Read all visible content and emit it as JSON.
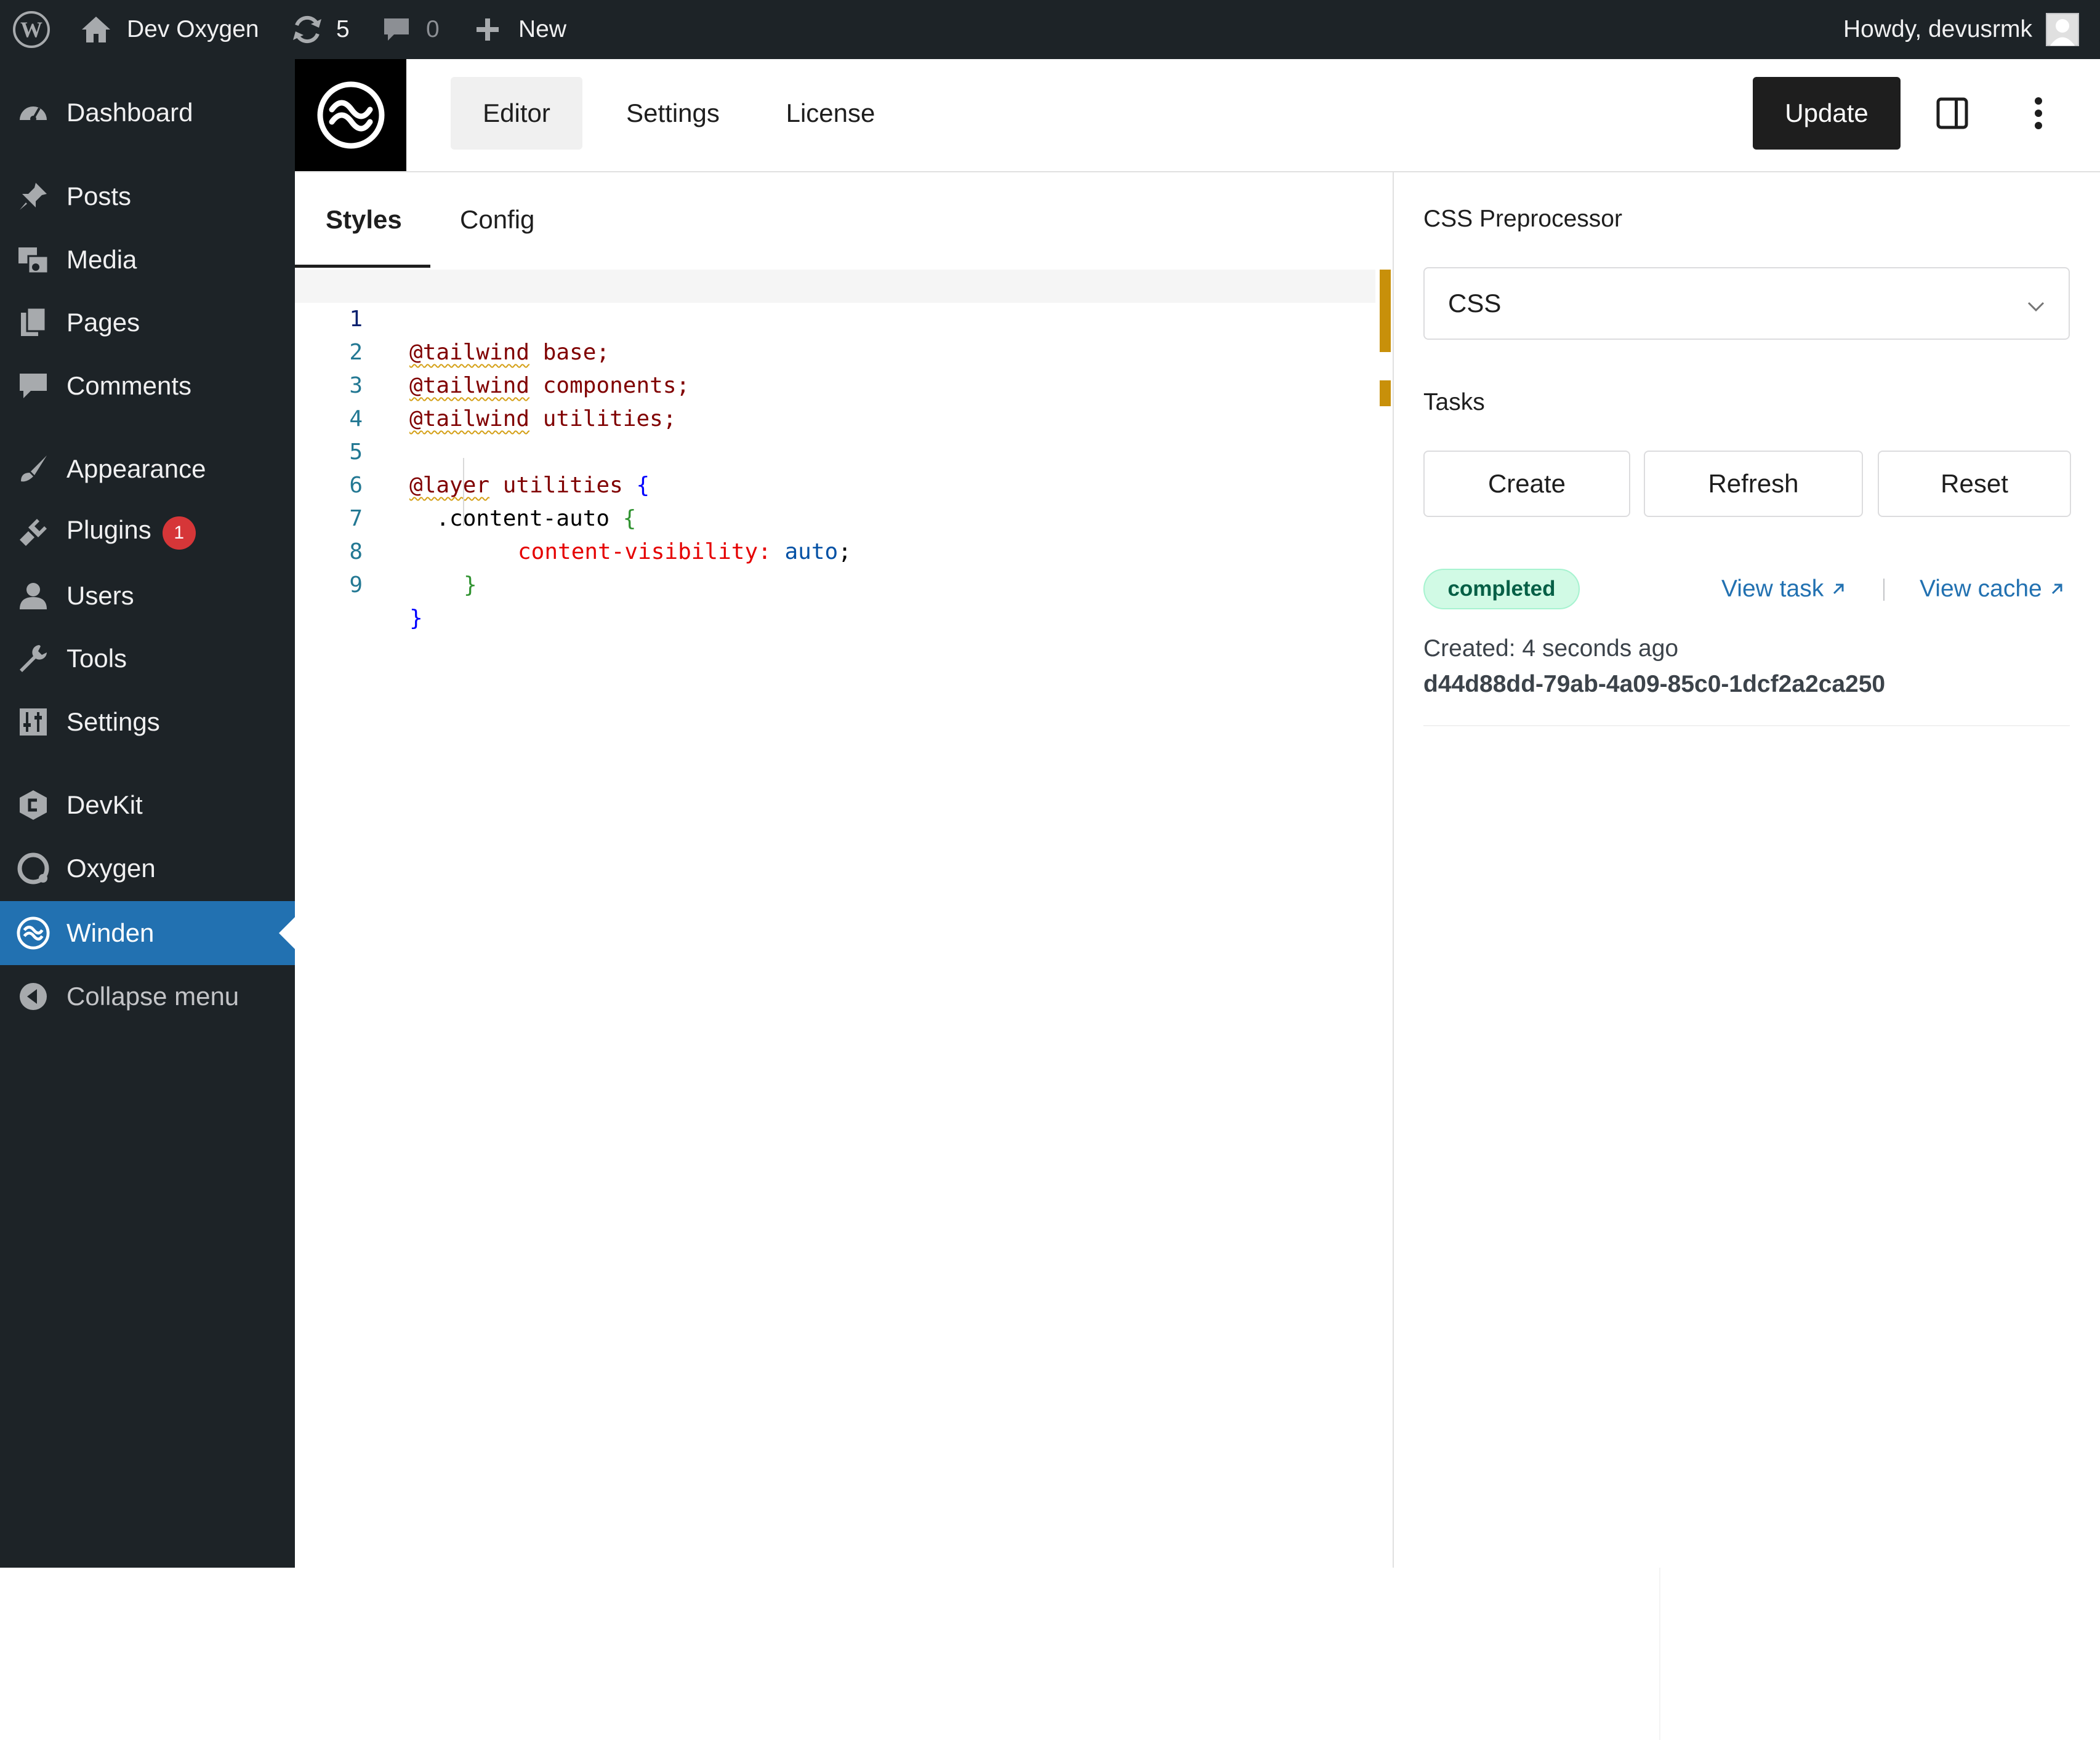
{
  "admin_bar": {
    "site_name": "Dev Oxygen",
    "updates_count": "5",
    "comments_count": "0",
    "new_label": "New",
    "howdy": "Howdy, devusrmk"
  },
  "sidebar": {
    "items": [
      {
        "label": "Dashboard",
        "icon": "dashboard-icon"
      },
      {
        "label": "Posts",
        "icon": "pin-icon"
      },
      {
        "label": "Media",
        "icon": "media-icon"
      },
      {
        "label": "Pages",
        "icon": "pages-icon"
      },
      {
        "label": "Comments",
        "icon": "comment-icon"
      },
      {
        "label": "Appearance",
        "icon": "brush-icon"
      },
      {
        "label": "Plugins",
        "icon": "plugin-icon",
        "badge": "1"
      },
      {
        "label": "Users",
        "icon": "user-icon"
      },
      {
        "label": "Tools",
        "icon": "wrench-icon"
      },
      {
        "label": "Settings",
        "icon": "sliders-icon"
      },
      {
        "label": "DevKit",
        "icon": "devkit-icon"
      },
      {
        "label": "Oxygen",
        "icon": "oxygen-icon"
      },
      {
        "label": "Winden",
        "icon": "winden-icon",
        "active": true
      },
      {
        "label": "Collapse menu",
        "icon": "collapse-icon"
      }
    ],
    "active_color": "#2271b1"
  },
  "header": {
    "tabs": [
      "Editor",
      "Settings",
      "License"
    ],
    "active_tab": "Editor",
    "update_label": "Update"
  },
  "editor": {
    "tabs": [
      "Styles",
      "Config"
    ],
    "active_tab": "Styles",
    "line_numbers": [
      "1",
      "2",
      "3",
      "4",
      "5",
      "6",
      "7",
      "8",
      "9"
    ],
    "lines": [
      {
        "at": "@",
        "kw": "tailwind",
        "rest": " base;"
      },
      {
        "at": "@",
        "kw": "tailwind",
        "rest": " components;"
      },
      {
        "at": "@",
        "kw": "tailwind",
        "rest": " utilities;"
      },
      {
        "empty": ""
      },
      {
        "at": "@",
        "kw": "layer",
        "rest": " utilities ",
        "brace": "{"
      },
      {
        "selector": "  .content-auto ",
        "brace": "{"
      },
      {
        "prop": "content-visibility:",
        "value": " auto",
        "semi": ";"
      },
      {
        "brace": "}"
      },
      {
        "brace": "}"
      }
    ]
  },
  "panel": {
    "preprocessor_label": "CSS Preprocessor",
    "preprocessor_value": "CSS",
    "tasks_label": "Tasks",
    "buttons": [
      "Create",
      "Refresh",
      "Reset"
    ],
    "status": "completed",
    "view_task": "View task",
    "view_cache": "View cache",
    "created": "Created: 4 seconds ago",
    "task_id": "d44d88dd-79ab-4a09-85c0-1dcf2a2ca250"
  }
}
